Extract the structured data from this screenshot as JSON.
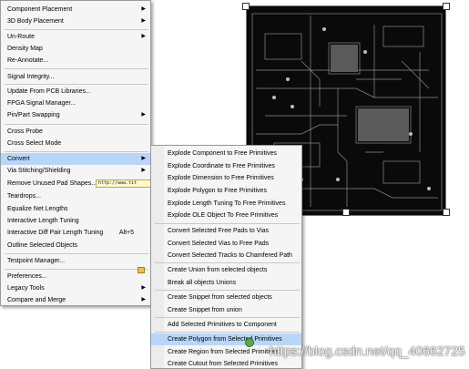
{
  "menu": {
    "items": [
      {
        "label": "Component Placement",
        "arrow": true
      },
      {
        "label": "3D Body Placement",
        "arrow": true
      },
      {
        "label": "Un-Route",
        "arrow": true
      },
      {
        "label": "Density Map"
      },
      {
        "label": "Re-Annotate..."
      },
      {
        "label": "Signal Integrity..."
      },
      {
        "label": "Update From PCB Libraries..."
      },
      {
        "label": "FPGA Signal Manager..."
      },
      {
        "label": "Pin/Part Swapping",
        "arrow": true
      },
      {
        "label": "Cross Probe"
      },
      {
        "label": "Cross Select Mode"
      },
      {
        "label": "Convert",
        "arrow": true,
        "highlighted": true
      },
      {
        "label": "Via Stitching/Shielding",
        "arrow": true
      },
      {
        "label": "Remove Unused Pad Shapes..."
      },
      {
        "label": "Teardrops..."
      },
      {
        "label": "Equalize Net Lengths"
      },
      {
        "label": "Interactive Length Tuning"
      },
      {
        "label": "Interactive Diff Pair Length Tuning",
        "accel": "Alt+5"
      },
      {
        "label": "Outline Selected Objects"
      },
      {
        "label": "Testpoint Manager..."
      },
      {
        "label": "Preferences..."
      },
      {
        "label": "Legacy Tools",
        "arrow": true
      },
      {
        "label": "Compare and Merge",
        "arrow": true
      }
    ],
    "tooltip": "http://www.tit"
  },
  "submenu": {
    "items": [
      {
        "label": "Explode Component to Free Primitives"
      },
      {
        "label": "Explode Coordinate to Free Primitives"
      },
      {
        "label": "Explode Dimension to Free Primitives"
      },
      {
        "label": "Explode Polygon to Free Primitives"
      },
      {
        "label": "Explode Length Tuning To Free Primitives"
      },
      {
        "label": "Explode OLE Object To Free Primitives"
      },
      {
        "label": "Convert Selected Free Pads to Vias"
      },
      {
        "label": "Convert Selected Vias to Free Pads"
      },
      {
        "label": "Convert Selected Tracks to Chamfered Path"
      },
      {
        "label": "Create Union from selected objects",
        "icon": "union-icon"
      },
      {
        "label": "Break all objects Unions"
      },
      {
        "label": "Create Snippet from selected objects"
      },
      {
        "label": "Create Snippet from union"
      },
      {
        "label": "Add Selected Primitives to Component"
      },
      {
        "label": "Create Polygon from Selected Primitives",
        "highlighted": true
      },
      {
        "label": "Create Region from Selected Primitives"
      },
      {
        "label": "Create Cutout from Selected Primitives"
      }
    ]
  },
  "watermark": "https://blog.csdn.net/qq_40662725",
  "colors": {
    "highlight": "#b8d6fa",
    "menu_bg": "#f5f5f5",
    "board_bg": "#0a0a0a",
    "trace": "#8a8a8a"
  }
}
